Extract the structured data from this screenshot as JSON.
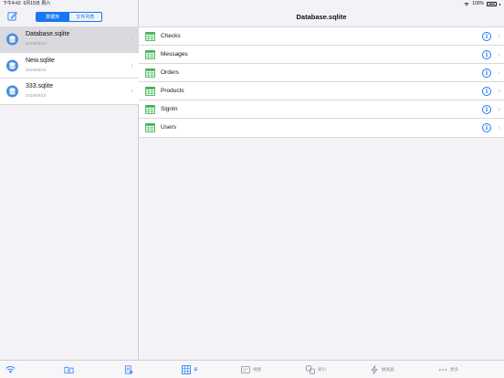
{
  "status": {
    "time": "下午4:42",
    "date": "6月15日 周六",
    "battery": "100%"
  },
  "sidebar": {
    "segments": [
      {
        "label": "数据库",
        "active": true
      },
      {
        "label": "文件列表",
        "active": false
      }
    ],
    "files": [
      {
        "name": "Database.sqlite",
        "date": "2019/05/10",
        "selected": true
      },
      {
        "name": "New.sqlite",
        "date": "2019/06/15",
        "selected": false
      },
      {
        "name": "333.sqlite",
        "date": "2019/06/15",
        "selected": false
      }
    ],
    "bottom_icons": [
      "wifi-icon",
      "folder-icon",
      "new-file-icon"
    ]
  },
  "main": {
    "title": "Database.sqlite",
    "tables": [
      "Checks",
      "Messages",
      "Orders",
      "Products",
      "SignIn",
      "Users"
    ]
  },
  "tabbar": [
    {
      "label": "表",
      "icon": "table-icon",
      "active": true
    },
    {
      "label": "视图",
      "icon": "view-icon",
      "active": false
    },
    {
      "label": "索引",
      "icon": "index-icon",
      "active": false
    },
    {
      "label": "触发器",
      "icon": "trigger-icon",
      "active": false
    },
    {
      "label": "更多",
      "icon": "more-icon",
      "active": false
    }
  ],
  "colors": {
    "accent": "#1877f2",
    "table_icon": "#37b24d",
    "db_icon": "#4a8fe0"
  }
}
